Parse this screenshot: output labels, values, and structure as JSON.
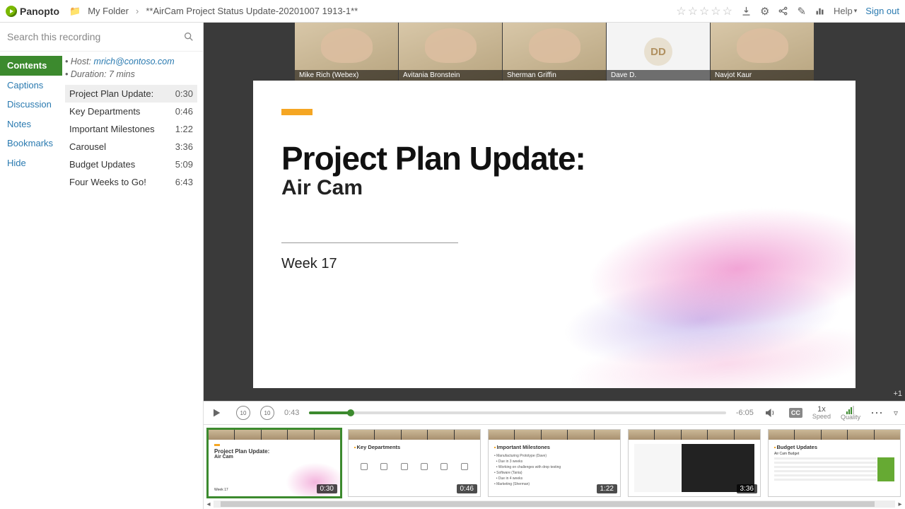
{
  "brand": "Panopto",
  "breadcrumb": {
    "folder": "My Folder",
    "title": "**AirCam Project Status Update-20201007 1913-1**"
  },
  "topbar": {
    "help_label": "Help",
    "signout_label": "Sign out"
  },
  "search": {
    "placeholder": "Search this recording"
  },
  "tabs": {
    "contents": "Contents",
    "captions": "Captions",
    "discussion": "Discussion",
    "notes": "Notes",
    "bookmarks": "Bookmarks",
    "hide": "Hide"
  },
  "meta": {
    "host_label": "Host:",
    "host_email": "mrich@contoso.com",
    "duration_label": "Duration: 7 mins"
  },
  "toc": [
    {
      "title": "Project Plan Update:",
      "time": "0:30",
      "selected": true
    },
    {
      "title": "Key Departments",
      "time": "0:46"
    },
    {
      "title": "Important Milestones",
      "time": "1:22"
    },
    {
      "title": "Carousel",
      "time": "3:36"
    },
    {
      "title": "Budget Updates",
      "time": "5:09"
    },
    {
      "title": "Four Weeks to Go!",
      "time": "6:43"
    }
  ],
  "participants": [
    {
      "name": "Mike Rich (Webex)"
    },
    {
      "name": "Avitania Bronstein"
    },
    {
      "name": "Sherman Griffin"
    },
    {
      "name": "Dave D.",
      "initials": "DD",
      "placeholder": true
    },
    {
      "name": "Navjot Kaur"
    }
  ],
  "overflow_count": "+1",
  "slide": {
    "title": "Project Plan Update:",
    "subtitle": "Air Cam",
    "week": "Week 17"
  },
  "player": {
    "current": "0:43",
    "remaining": "-6:05",
    "progress_pct": 10,
    "speed_top": "1x",
    "speed_label": "Speed",
    "quality_label": "Quality",
    "cc": "CC"
  },
  "thumbnails": [
    {
      "time": "0:30",
      "heading": "Project Plan Update:",
      "sub": "Air Cam",
      "active": true,
      "style": "title"
    },
    {
      "time": "0:46",
      "heading": "Key Departments",
      "style": "depts"
    },
    {
      "time": "1:22",
      "heading": "Important Milestones",
      "style": "bullets"
    },
    {
      "time": "3:36",
      "heading": "",
      "style": "screenshot"
    },
    {
      "time": "",
      "heading": "Budget Updates",
      "style": "budget"
    }
  ]
}
